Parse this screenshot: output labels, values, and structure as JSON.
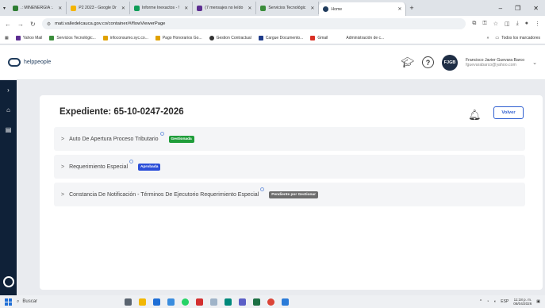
{
  "browser": {
    "tabs": [
      {
        "label": ".: MINENERGIA :.",
        "color": "#2e7d32"
      },
      {
        "label": "P2 2023 - Google Dr",
        "color": "#f4b400"
      },
      {
        "label": "Informe Inexactos - !",
        "color": "#0f9d58"
      },
      {
        "label": "(7 mensajes no leído",
        "color": "#5c2d91"
      },
      {
        "label": "Servicios Tecnológic",
        "color": "#3b8d3b"
      },
      {
        "label": "Home",
        "color": "#1f3b5c"
      }
    ],
    "url": "mati.valledelcauca.gov.co/container/#/flowViewerPage",
    "bookmarks": [
      {
        "label": "Yahoo Mail",
        "color": "#5c2d91"
      },
      {
        "label": "Servicios Tecnológic...",
        "color": "#3b8d3b"
      },
      {
        "label": "infoconsumo.syc.co...",
        "color": "#e0a100"
      },
      {
        "label": "Pago Honorarios Go...",
        "color": "#e0a100"
      },
      {
        "label": "Gestion Contractual",
        "color": "#333333"
      },
      {
        "label": "Cargue Documento...",
        "color": "#1f3b8a"
      },
      {
        "label": "Gmail",
        "color": "#d93025"
      },
      {
        "label": "Administración de c...",
        "color": "#ffffff"
      }
    ],
    "all_bookmarks": "Todos los marcadores"
  },
  "app": {
    "logo_text": "helppeople",
    "user_initials": "FJGB",
    "user_name": "Francisco Javier Guevara Barco",
    "user_email": "fguevarabarco@yahoo.com"
  },
  "main": {
    "title": "Expediente: 65-10-0247-2026",
    "back_label": "Volver",
    "items": [
      {
        "label": "Auto De Apertura Proceso Tributario",
        "status": "Gestionada",
        "status_color": "#1f9d3a"
      },
      {
        "label": "Requerimiento Especial",
        "status": "Aprobada",
        "status_color": "#2c4fd8"
      },
      {
        "label": "Constancia De Notificación - Términos De Ejecutorio Requerimiento Especial",
        "status": "Pendiente por Gestionar",
        "status_color": "#6d6d6d"
      }
    ]
  },
  "taskbar": {
    "search_placeholder": "Buscar",
    "language": "ESP",
    "time": "11:18 p. m.",
    "date": "08/04/2026"
  }
}
